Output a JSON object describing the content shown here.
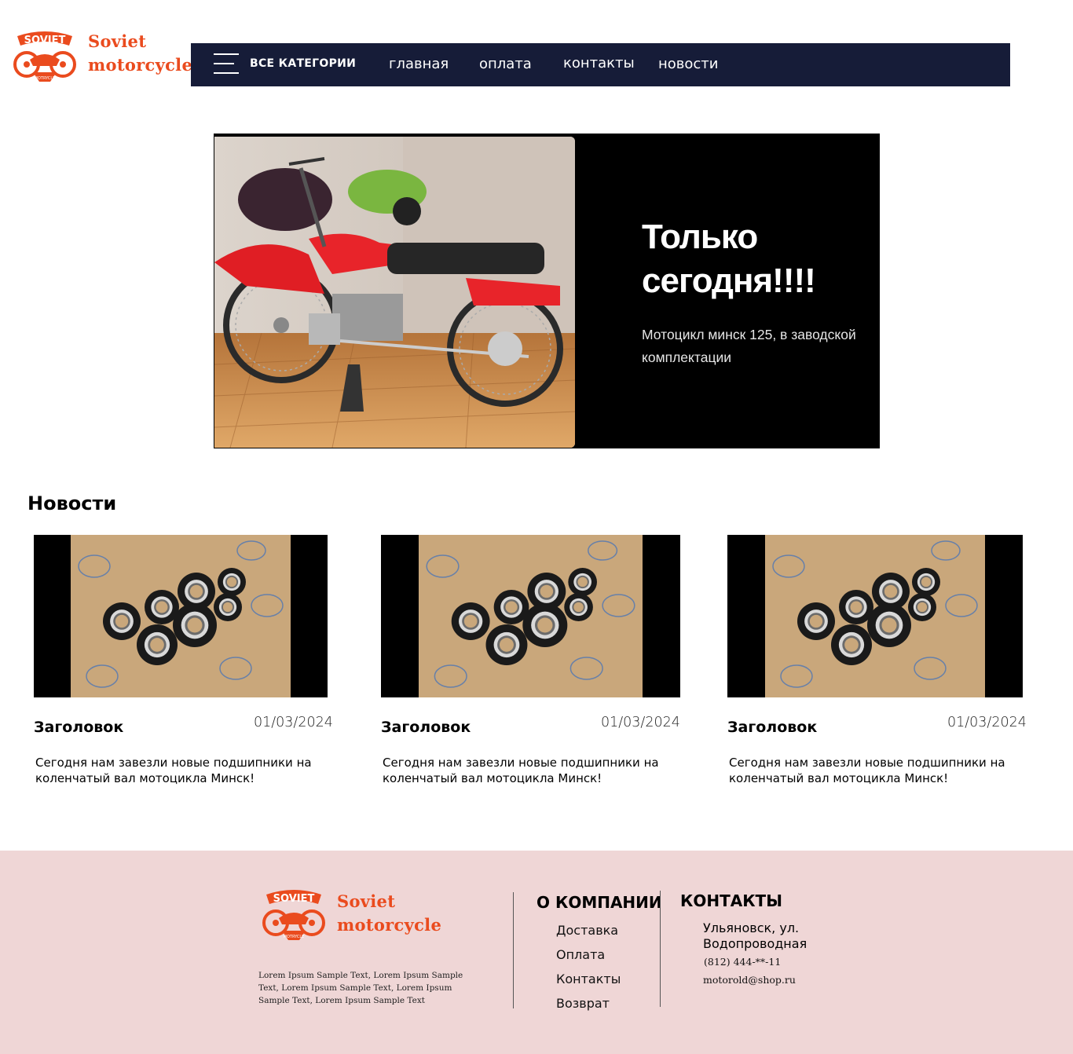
{
  "header": {
    "logo_line1": "Soviet",
    "logo_line2": "motorcycle",
    "all_categories": "ВСЕ КАТЕГОРИИ",
    "nav": [
      "главная",
      "оплата",
      "контакты",
      "новости"
    ]
  },
  "hero": {
    "title": "Только сегодня!!!!",
    "subtitle": "Мотоцикл минск 125, в заводской комплектации"
  },
  "news": {
    "heading": "Новости",
    "cards": [
      {
        "title": "Заголовок",
        "date": "01/03/2024",
        "text": "Сегодня нам завезли новые подшипники на коленчатый вал мотоцикла Минск!"
      },
      {
        "title": "Заголовок",
        "date": "01/03/2024",
        "text": "Сегодня нам завезли новые подшипники на коленчатый вал мотоцикла Минск!"
      },
      {
        "title": "Заголовок",
        "date": "01/03/2024",
        "text": "Сегодня нам завезли новые подшипники на коленчатый вал мотоцикла Минск!"
      }
    ]
  },
  "footer": {
    "logo_line1": "Soviet",
    "logo_line2": "motorcycle",
    "lorem": "Lorem Ipsum Sample Text, Lorem Ipsum Sample Text, Lorem Ipsum Sample Text, Lorem Ipsum Sample Text, Lorem Ipsum Sample Text",
    "company_heading": "О КОМПАНИИ",
    "company_links": [
      "Доставка",
      "Оплата",
      "Контакты",
      "Возврат"
    ],
    "contacts_heading": "КОНТАКТЫ",
    "address": "Ульяновск, ул. Водопроводная",
    "phone": "(812) 444-**-11",
    "email": "motorold@shop.ru"
  },
  "colors": {
    "navbar": "#161c38",
    "brand": "#ea4b1e",
    "footer_bg": "#efd6d6",
    "hero_bg": "#000000"
  },
  "icons": [
    "menu-icon",
    "logo-emblem"
  ]
}
